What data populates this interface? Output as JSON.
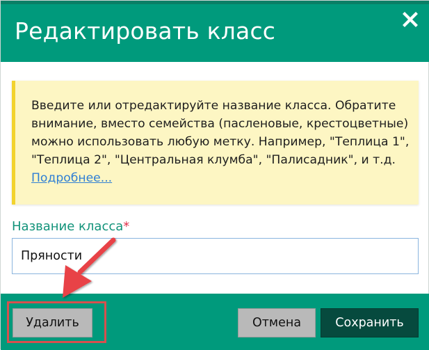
{
  "dialog": {
    "title": "Редактировать класс",
    "close_icon": "close-icon"
  },
  "notice": {
    "text": "Введите или отредактируйте название класса. Обратите внимание, вместо семейства (пасленовые, крестоцветные) можно использовать любую метку. Например, \"Теплица 1\", \"Теплица 2\", \"Центральная клумба\", \"Палисадник\", и т.д. ",
    "link_text": "Подробнее..."
  },
  "field": {
    "label": "Название класса",
    "required_mark": "*",
    "value": "Пряности"
  },
  "buttons": {
    "delete": "Удалить",
    "cancel": "Отмена",
    "save": "Сохранить"
  },
  "annotation": {
    "arrow_icon": "arrow-icon",
    "highlight_target": "delete-button"
  },
  "colors": {
    "header": "#009a7c",
    "footer": "#009a7c",
    "notice_background": "#fdf6c3",
    "notice_border": "#f2d32e",
    "label": "#12937a",
    "required": "#e0304a",
    "link": "#2f7fd4",
    "save_button": "#064a3e",
    "secondary_button": "#b9b9b9",
    "annotation": "#e84346"
  }
}
